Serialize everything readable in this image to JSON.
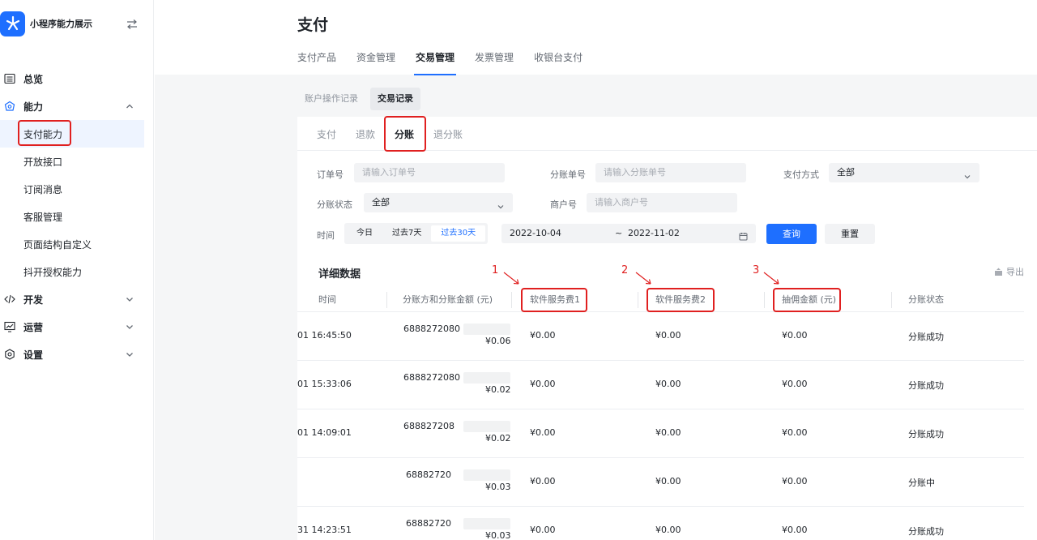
{
  "sidebar": {
    "app_name": "小程序能力展示",
    "items": [
      {
        "label": "总览",
        "icon": "dashboard-icon"
      },
      {
        "label": "能力",
        "icon": "ability-icon"
      },
      {
        "label": "开发",
        "icon": "code-icon"
      },
      {
        "label": "运营",
        "icon": "chart-icon"
      },
      {
        "label": "设置",
        "icon": "settings-icon"
      }
    ],
    "ability_subitems": [
      "支付能力",
      "开放接口",
      "订阅消息",
      "客服管理",
      "页面结构自定义",
      "抖开授权能力"
    ]
  },
  "page": {
    "title": "支付",
    "tabs": [
      "支付产品",
      "资金管理",
      "交易管理",
      "发票管理",
      "收银台支付"
    ]
  },
  "subtabs": [
    "账户操作记录",
    "交易记录"
  ],
  "inner_tabs": [
    "支付",
    "退款",
    "分账",
    "退分账"
  ],
  "filters": {
    "order_no_label": "订单号",
    "order_no_placeholder": "请输入订单号",
    "split_no_label": "分账单号",
    "split_no_placeholder": "请输入分账单号",
    "pay_method_label": "支付方式",
    "pay_method_value": "全部",
    "split_status_label": "分账状态",
    "split_status_value": "全部",
    "merchant_label": "商户号",
    "merchant_placeholder": "请输入商户号",
    "time_label": "时间",
    "quick_ranges": [
      "今日",
      "过去7天",
      "过去30天"
    ],
    "date_start": "2022-10-04",
    "date_sep": "~",
    "date_end": "2022-11-02",
    "query_button": "查询",
    "reset_button": "重置"
  },
  "detail": {
    "title": "详细数据",
    "export_label": "导出",
    "columns": [
      "时间",
      "分账方和分账金额 (元)",
      "软件服务费1",
      "软件服务费2",
      "抽佣金额 (元)",
      "分账状态"
    ],
    "rows": [
      {
        "time": "01 16:45:50",
        "party": "6888272080",
        "amount": "¥0.06",
        "fee1": "¥0.00",
        "fee2": "¥0.00",
        "commission": "¥0.00",
        "status": "分账成功"
      },
      {
        "time": "01 15:33:06",
        "party": "6888272080",
        "amount": "¥0.02",
        "fee1": "¥0.00",
        "fee2": "¥0.00",
        "commission": "¥0.00",
        "status": "分账成功"
      },
      {
        "time": "01 14:09:01",
        "party": "688827208",
        "amount": "¥0.02",
        "fee1": "¥0.00",
        "fee2": "¥0.00",
        "commission": "¥0.00",
        "status": "分账成功"
      },
      {
        "time": "",
        "party": "68882720",
        "amount": "¥0.03",
        "fee1": "¥0.00",
        "fee2": "¥0.00",
        "commission": "¥0.00",
        "status": "分账中"
      },
      {
        "time": "31 14:23:51",
        "party": "68882720",
        "amount": "¥0.03",
        "fee1": "¥0.00",
        "fee2": "¥0.00",
        "commission": "¥0.00",
        "status": "分账成功"
      }
    ]
  },
  "annotations": [
    "1",
    "2",
    "3"
  ],
  "colors": {
    "accent": "#1e6fff",
    "highlight": "#e02020"
  }
}
